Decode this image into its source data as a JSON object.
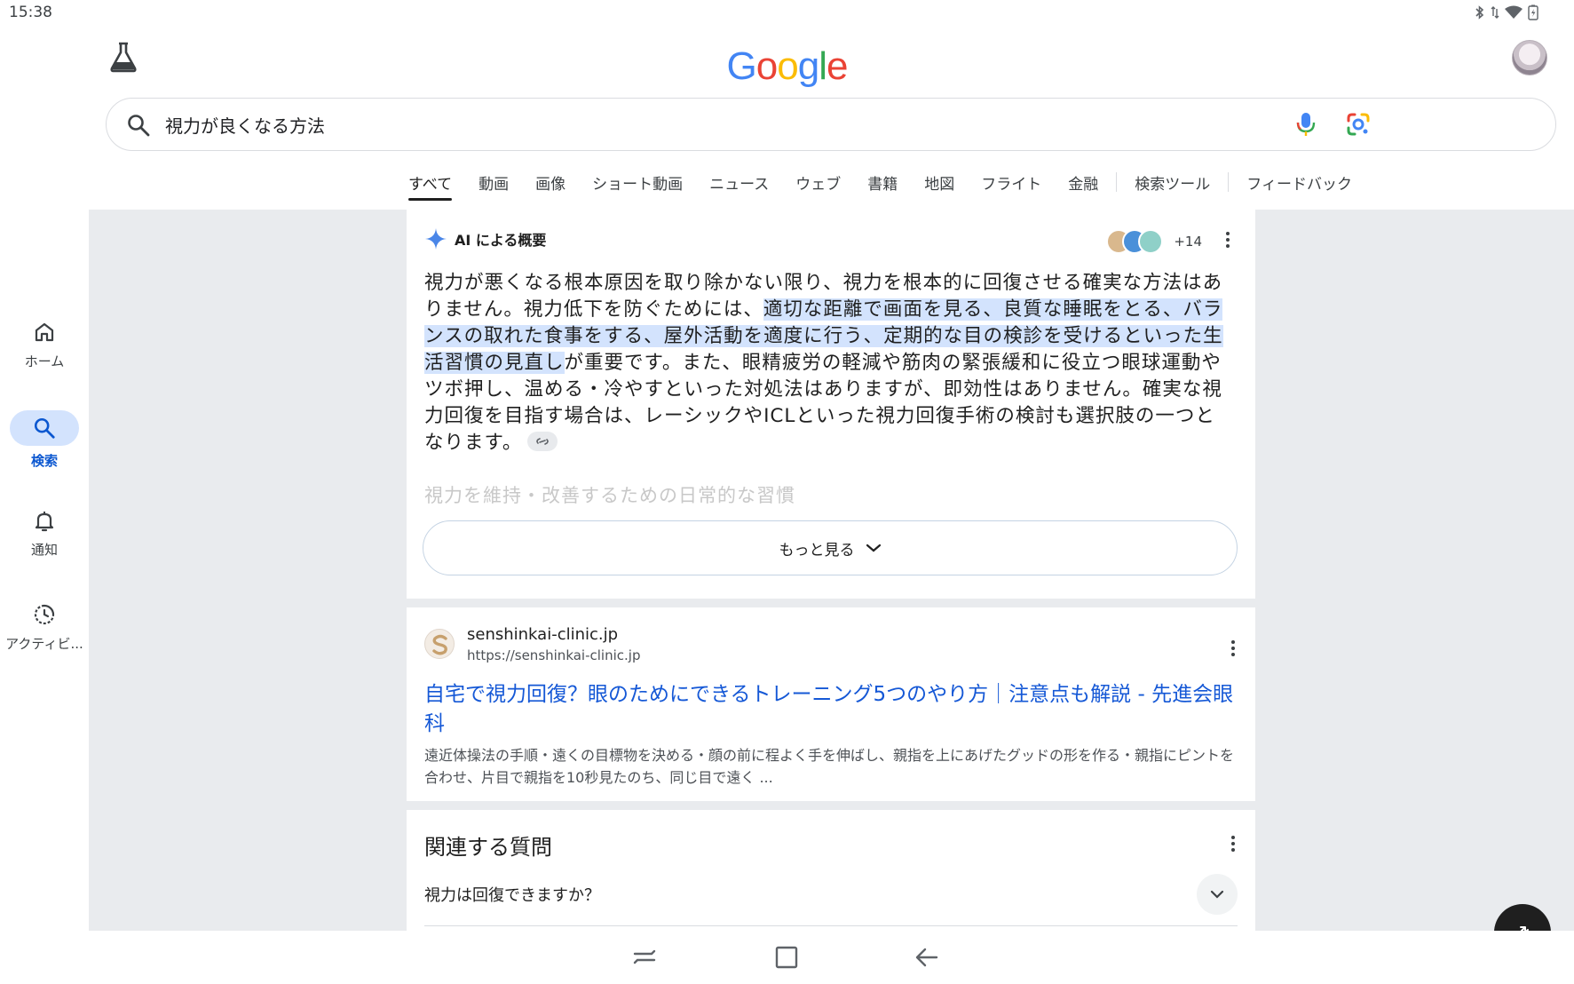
{
  "status_bar": {
    "time": "15:38"
  },
  "header": {
    "logo_letters": [
      {
        "ch": "G",
        "color": "#4285f4"
      },
      {
        "ch": "o",
        "color": "#ea4335"
      },
      {
        "ch": "o",
        "color": "#fbbc05"
      },
      {
        "ch": "g",
        "color": "#4285f4"
      },
      {
        "ch": "l",
        "color": "#34a853"
      },
      {
        "ch": "e",
        "color": "#ea4335"
      }
    ]
  },
  "search": {
    "query": "視力が良くなる方法"
  },
  "tabs": [
    "すべて",
    "動画",
    "画像",
    "ショート動画",
    "ニュース",
    "ウェブ",
    "書籍",
    "地図",
    "フライト",
    "金融",
    "検索ツール",
    "フィードバック"
  ],
  "left_nav": {
    "home": "ホーム",
    "search": "検索",
    "notifications": "通知",
    "activity": "アクティビ..."
  },
  "ai_overview": {
    "label": "AI による概要",
    "sources_count": "+14",
    "text_before": "視力が悪くなる根本原因を取り除かない限り、視力を根本的に回復させる確実な方法はありません。視力低下を防ぐためには、",
    "text_highlight": "適切な距離で画面を見る、良質な睡眠をとる、バランスの取れた食事をする、屋外活動を適度に行う、定期的な目の検診を受けるといった生活習慣の見直し",
    "text_after": "が重要です。また、眼精疲労の軽減や筋肉の緊張緩和に役立つ眼球運動やツボ押し、温める・冷やすといった対処法はありますが、即効性はありません。確実な視力回復を目指す場合は、レーシックやICLといった視力回復手術の検討も選択肢の一つとなります。",
    "faded_heading": "視力を維持・改善するための日常的な習慣",
    "show_more": "もっと見る"
  },
  "result": {
    "site_name": "senshinkai-clinic.jp",
    "url": "https://senshinkai-clinic.jp",
    "title": "自宅で視力回復？眼のためにできるトレーニング5つのやり方｜注意点も解説 - 先進会眼科",
    "snippet": "遠近体操法の手順・遠くの目標物を決める・顔の前に程よく手を伸ばし、親指を上にあげたグッドの形を作る・親指にピントを合わせ、片目で親指を10秒見たのち、同じ目で遠く ..."
  },
  "related_questions": {
    "title": "関連する質問",
    "questions": [
      "視力は回復できますか？"
    ]
  },
  "colors": {
    "accent": "#0b57d0",
    "highlight": "#d3e3fd",
    "link": "#1558d6",
    "page_bg": "#e9ebee"
  }
}
